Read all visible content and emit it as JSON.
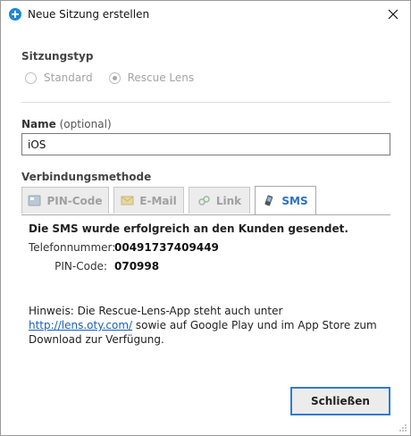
{
  "window": {
    "title": "Neue Sitzung erstellen"
  },
  "session_type": {
    "label": "Sitzungstyp",
    "options": [
      {
        "label": "Standard",
        "checked": false
      },
      {
        "label": "Rescue Lens",
        "checked": true
      }
    ]
  },
  "name_field": {
    "label": "Name",
    "optional": "(optional)",
    "value": "iOS"
  },
  "connection": {
    "label": "Verbindungsmethode",
    "tabs": [
      {
        "label": "PIN-Code",
        "icon": "pin-code-icon",
        "active": false
      },
      {
        "label": "E-Mail",
        "icon": "email-icon",
        "active": false
      },
      {
        "label": "Link",
        "icon": "link-icon",
        "active": false
      },
      {
        "label": "SMS",
        "icon": "phone-icon",
        "active": true
      }
    ]
  },
  "sms_panel": {
    "success_message": "Die SMS wurde erfolgreich an den Kunden gesendet.",
    "phone_label": "Telefonnummer:",
    "phone_value": "00491737409449",
    "pin_label": "PIN-Code:",
    "pin_value": "070998",
    "hint_prefix": "Hinweis: Die Rescue-Lens-App steht auch unter ",
    "hint_link": "http://lens.oty.com/",
    "hint_suffix": " sowie auf Google Play und im App Store zum Download zur Verfügung."
  },
  "buttons": {
    "close_label": "Schließen"
  },
  "colors": {
    "accent": "#2d7dd2",
    "link": "#1a5fbf",
    "active_tab_text": "#2a73c9"
  }
}
